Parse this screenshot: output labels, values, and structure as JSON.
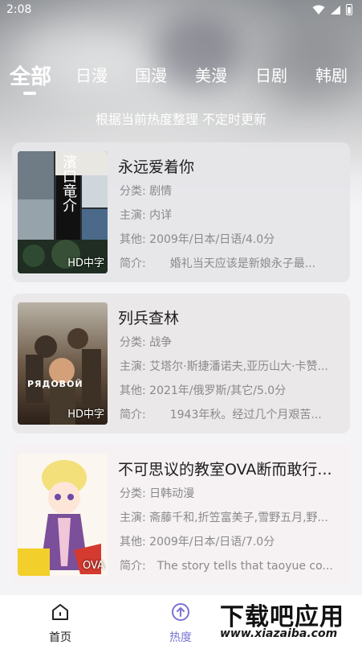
{
  "status": {
    "time": "2:08"
  },
  "tabs": [
    "全部",
    "日漫",
    "国漫",
    "美漫",
    "日剧",
    "韩剧"
  ],
  "subtitle": "根据当前热度整理 不定时更新",
  "labels": {
    "category": "分类:",
    "cast": "主演:",
    "other": "其他:",
    "intro": "简介:"
  },
  "items": [
    {
      "title": "永远爱着你",
      "category": "剧情",
      "cast": "内详",
      "other": "2009年/日本/日语/4.0分",
      "intro": "婚礼当天应该是新娘永子最...",
      "badge": "HD中字",
      "poster_text": "濱口竜介",
      "colors": {
        "poster": "#2b2e33"
      }
    },
    {
      "title": "列兵查林",
      "category": "战争",
      "cast": "艾塔尔·斯捷潘诺夫,亚历山大·卡赞...",
      "other": "2021年/俄罗斯/其它/5.0分",
      "intro": "1943年秋。经过几个月艰苦...",
      "badge": "HD中字",
      "poster_text": "РЯДОВОЙ",
      "colors": {
        "poster": "#5b4a3b"
      }
    },
    {
      "title": "不可思议的教室OVA断而敢行...",
      "category": "日韩动漫",
      "cast": "斋藤千和,折笠富美子,雪野五月,野...",
      "other": "2009年/日本/日语/7.0分",
      "intro": "The story tells that taoyue co...",
      "badge": "OVA",
      "colors": {
        "poster": "#fbf6ef"
      }
    }
  ],
  "nav": {
    "home": "首页",
    "hot": "热度"
  },
  "watermark": {
    "title": "下载吧应用",
    "url": "www.xiazaiba.com"
  },
  "colors": {
    "accent": "#7a73d4"
  }
}
